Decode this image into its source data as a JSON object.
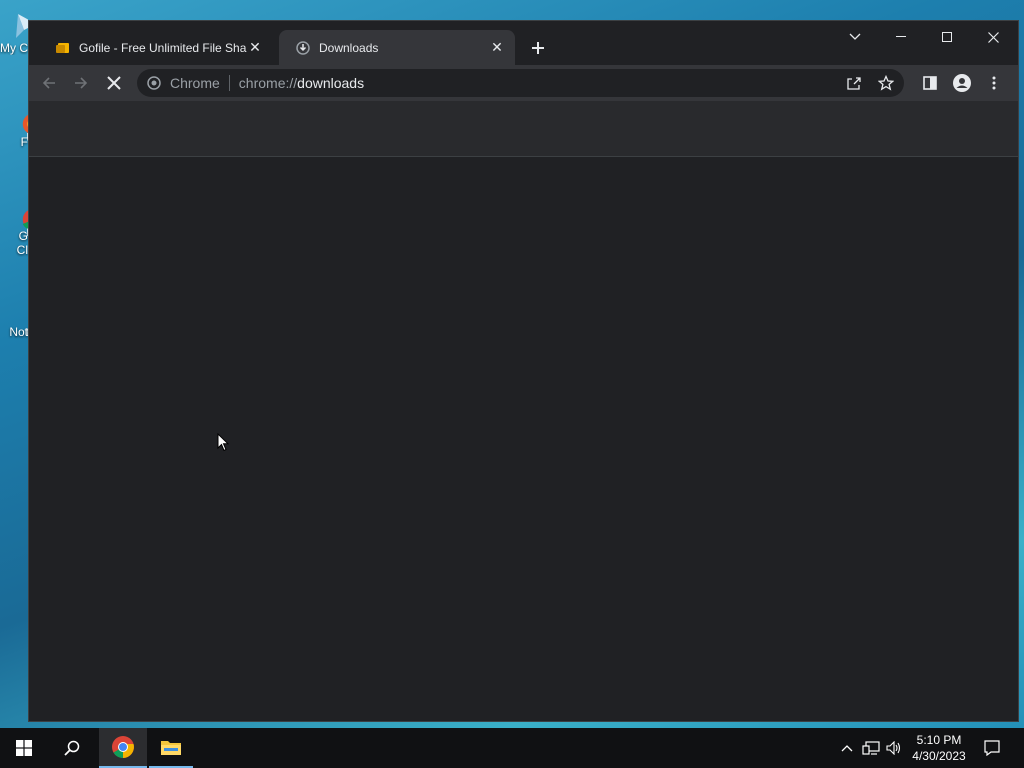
{
  "desktop": {
    "icons": [
      {
        "label": "My C",
        "icon": "computer-icon"
      },
      {
        "label": "F",
        "icon": "firefox-icon"
      },
      {
        "label": "G",
        "label2": "Cl",
        "icon": "chrome-icon"
      },
      {
        "label": "Not",
        "icon": "notepad-icon"
      }
    ]
  },
  "browser": {
    "tabs": [
      {
        "title": "Gofile - Free Unlimited File Sharing",
        "favicon": "gofile-icon",
        "active": false
      },
      {
        "title": "Downloads",
        "favicon": "download-icon",
        "active": true
      }
    ],
    "omnibox": {
      "site_name": "Chrome",
      "url_scheme": "chrome://",
      "url_path": "downloads"
    },
    "loading": true
  },
  "taskbar": {
    "apps": [
      "windows-start-icon",
      "search-icon",
      "chrome-icon",
      "file-explorer-icon"
    ],
    "clock": {
      "time": "5:10 PM",
      "date": "4/30/2023"
    },
    "tray": [
      "chevron-up-icon",
      "network-icon",
      "volume-icon",
      "notification-icon"
    ]
  },
  "colors": {
    "window_bg": "#202124",
    "toolbar_bg": "#35363a",
    "accent": "#76b9ed"
  }
}
